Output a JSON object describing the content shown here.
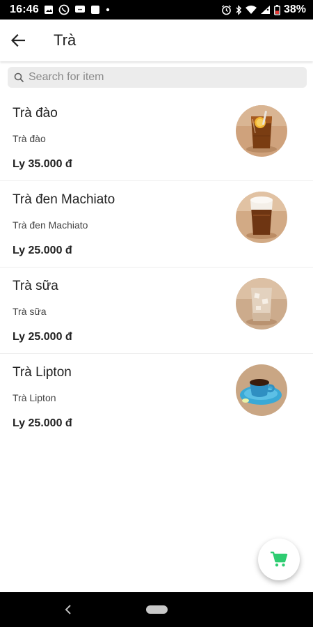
{
  "status_bar": {
    "time": "16:46",
    "battery_percent": "38%",
    "icons_left": [
      "image-icon",
      "viber-icon",
      "chat-icon",
      "square-icon",
      "dot-icon"
    ],
    "icons_right": [
      "alarm-icon",
      "bluetooth-icon",
      "wifi-icon",
      "signal-icon",
      "battery-icon"
    ]
  },
  "app_bar": {
    "title": "Trà",
    "back_icon": "arrow-left-icon"
  },
  "search": {
    "placeholder": "Search for item",
    "value": "",
    "icon": "search-icon"
  },
  "items": [
    {
      "name": "Trà đào",
      "description": "Trà đào",
      "price": "Ly 35.000 đ",
      "photo": "peach-tea-photo"
    },
    {
      "name": "Trà đen Machiato",
      "description": "Trà đen Machiato",
      "price": "Ly 25.000 đ",
      "photo": "black-tea-macchiato-photo"
    },
    {
      "name": "Trà sữa",
      "description": "Trà sữa",
      "price": "Ly 25.000 đ",
      "photo": "milk-tea-photo"
    },
    {
      "name": "Trà Lipton",
      "description": "Trà Lipton",
      "price": "Ly 25.000 đ",
      "photo": "lipton-tea-photo"
    }
  ],
  "fab": {
    "icon": "shopping-cart-icon",
    "color": "#2ecc71"
  },
  "colors": {
    "accent": "#2ecc71",
    "text": "#212121",
    "search_bg": "#ececec"
  }
}
